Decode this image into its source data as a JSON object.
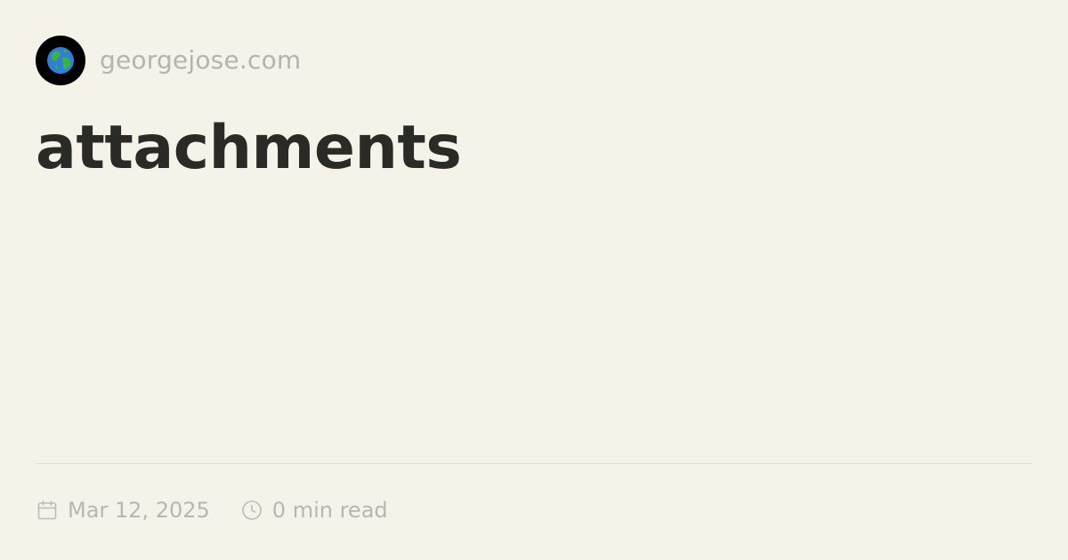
{
  "site": {
    "name": "georgejose.com",
    "avatar_icon": "earth-globe-icon"
  },
  "post": {
    "title": "attachments",
    "date": "Mar 12, 2025",
    "read_time": "0 min read"
  },
  "icons": {
    "date": "calendar-icon",
    "read_time": "clock-icon"
  },
  "colors": {
    "background": "#f5f2ea",
    "title": "#2a2a26",
    "muted": "#b8b6b0",
    "divider": "#e2dfd6",
    "globe_ocean": "#2f7fd6",
    "globe_land": "#3bb34a"
  }
}
